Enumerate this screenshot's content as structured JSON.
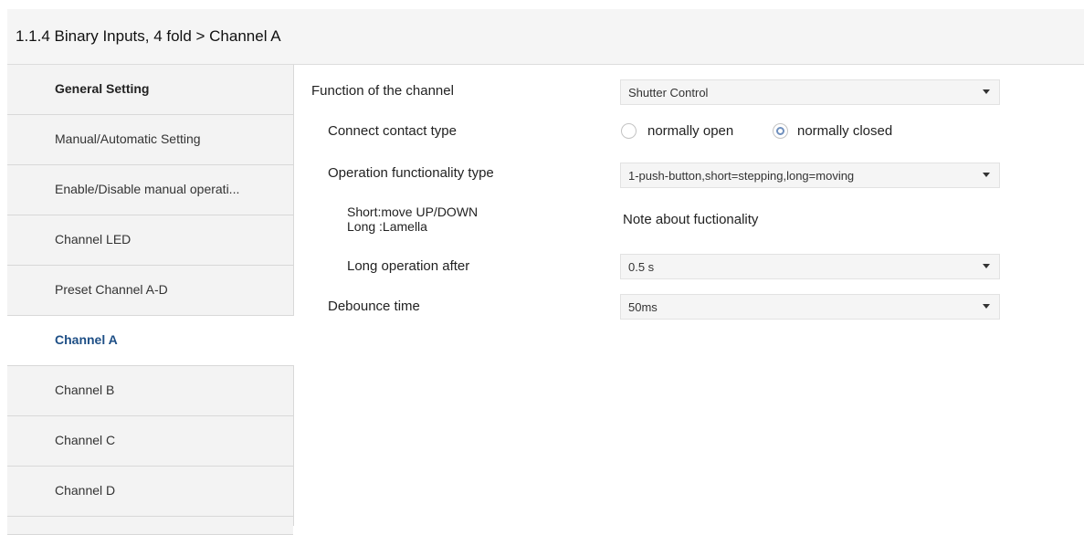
{
  "header": {
    "title": "1.1.4 Binary Inputs, 4 fold > Channel A"
  },
  "sidebar": {
    "items": [
      {
        "label": "General Setting"
      },
      {
        "label": "Manual/Automatic Setting"
      },
      {
        "label": "Enable/Disable manual operati..."
      },
      {
        "label": "Channel LED"
      },
      {
        "label": "Preset Channel A-D"
      },
      {
        "label": "Channel A"
      },
      {
        "label": "Channel B"
      },
      {
        "label": "Channel C"
      },
      {
        "label": "Channel D"
      }
    ],
    "active": "Channel A"
  },
  "params": {
    "function_label": "Function of the channel",
    "function_value": "Shutter Control",
    "contact_label": "Connect contact type",
    "contact_options": [
      "normally open",
      "normally closed"
    ],
    "contact_selected": "normally closed",
    "operation_label": "Operation functionality type",
    "operation_value": "1-push-button,short=stepping,long=moving",
    "note_line1": "Short:move UP/DOWN",
    "note_line2": "Long :Lamella",
    "note_value": "Note about fuctionality",
    "long_op_label": "Long operation after",
    "long_op_value": "0.5 s",
    "debounce_label": "Debounce time",
    "debounce_value": "50ms"
  }
}
